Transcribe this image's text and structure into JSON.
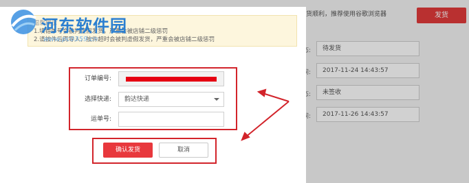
{
  "background": {
    "banner_text": "为保证您发货顺利，推荐使用谷歌浏览器",
    "ship_button": "发货",
    "rows": [
      {
        "label": "态:",
        "value": "待发货"
      },
      {
        "label": "间:",
        "value": "2017-11-24 14:43:57"
      },
      {
        "label": "态:",
        "value": "未签收"
      },
      {
        "label": "间:",
        "value": "2017-11-26 14:43:57"
      }
    ]
  },
  "notice": {
    "title": "温馨提示",
    "line1": "1.填错单号会被判虚假发货，严重会被店铺二级惩罚",
    "line2": "2.请按件后再导入，按件超时会被判虚假发货，严重会被店铺二级惩罚"
  },
  "form": {
    "order_label": "订单编号:",
    "courier_label": "选择快递:",
    "courier_value": "韵达快递",
    "tracking_label": "运单号:",
    "tracking_value": ""
  },
  "buttons": {
    "confirm": "确认发货",
    "cancel": "取消"
  },
  "watermark": {
    "name": "河东软件园",
    "url": "www.pc0359.cn"
  },
  "colors": {
    "accent_red": "#e8383d",
    "highlight_red": "#d2232a",
    "redaction": "#e60012",
    "notice_bg": "#fdf6dd"
  }
}
